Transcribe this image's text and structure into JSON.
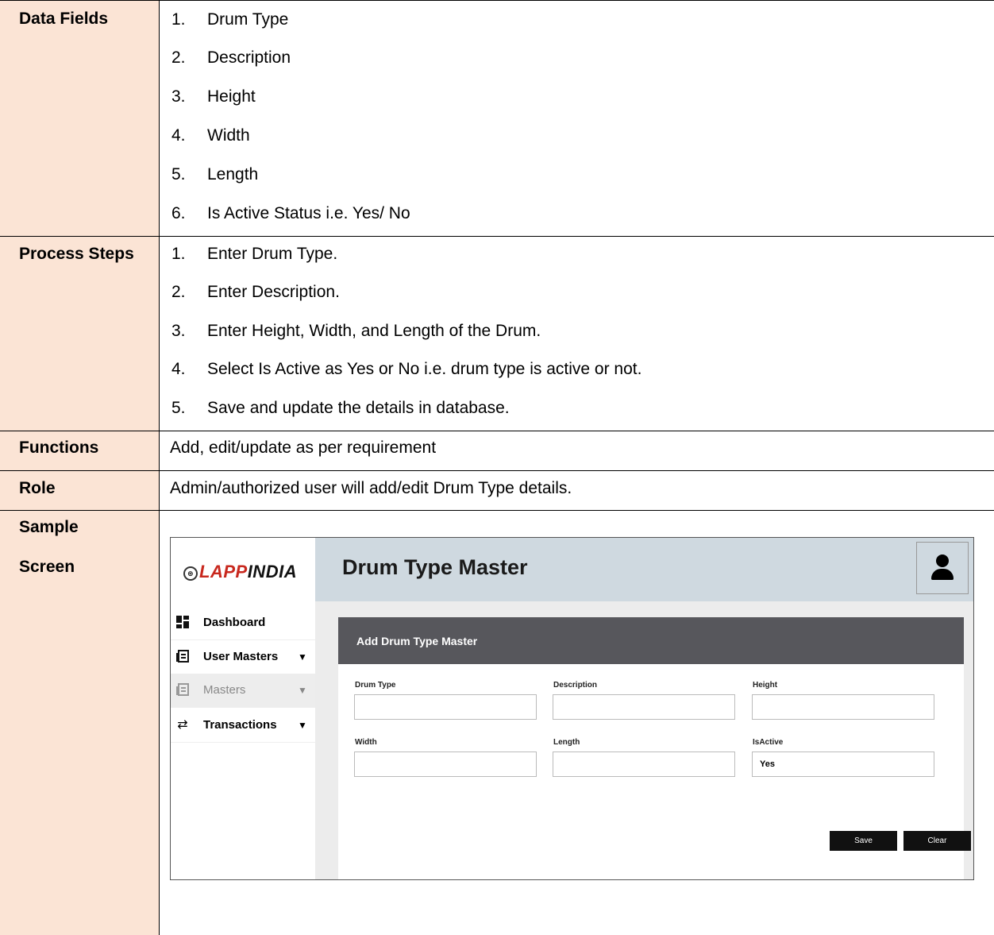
{
  "rows": {
    "data_fields": {
      "label": "Data Fields",
      "items": [
        {
          "num": "1.",
          "text": "Drum Type"
        },
        {
          "num": "2.",
          "text": "Description"
        },
        {
          "num": "3.",
          "text": "Height"
        },
        {
          "num": "4.",
          "text": "Width"
        },
        {
          "num": "5.",
          "text": "Length"
        },
        {
          "num": "6.",
          "text": "Is Active Status i.e. Yes/ No"
        }
      ]
    },
    "process_steps": {
      "label": "Process Steps",
      "items": [
        {
          "num": "1.",
          "text": "Enter Drum Type."
        },
        {
          "num": "2.",
          "text": "Enter Description."
        },
        {
          "num": "3.",
          "text": "Enter Height, Width, and Length of the Drum."
        },
        {
          "num": "4.",
          "text": "Select Is Active as Yes or No i.e. drum type is active or not."
        },
        {
          "num": "5.",
          "text": "Save and update the details in database."
        }
      ]
    },
    "functions": {
      "label": "Functions",
      "text": "Add, edit/update as per requirement"
    },
    "role": {
      "label": "Role",
      "text": "Admin/authorized user will add/edit Drum Type details."
    },
    "sample_screen": {
      "label_line1": "Sample",
      "label_line2": "Screen"
    }
  },
  "screen": {
    "logo_text": "LAPP INDIA",
    "logo_lapp": "LAPP",
    "logo_india": "INDIA",
    "page_title": "Drum Type Master",
    "nav": [
      {
        "label": "Dashboard",
        "icon": "dashboard-icon"
      },
      {
        "label": "User Masters",
        "icon": "list-icon",
        "arrow": "▼"
      },
      {
        "label": "Masters",
        "icon": "list-icon",
        "arrow": "▼"
      },
      {
        "label": "Transactions",
        "icon": "transfer-icon",
        "arrow": "▼"
      }
    ],
    "panel_title": "Add Drum Type Master",
    "fields": {
      "drum_type": {
        "label": "Drum Type",
        "value": ""
      },
      "description": {
        "label": "Description",
        "value": ""
      },
      "height": {
        "label": "Height",
        "value": ""
      },
      "width": {
        "label": "Width",
        "value": ""
      },
      "length": {
        "label": "Length",
        "value": ""
      },
      "is_active": {
        "label": "IsActive",
        "value": "Yes"
      }
    },
    "buttons": {
      "save": "Save",
      "clear": "Clear"
    }
  }
}
